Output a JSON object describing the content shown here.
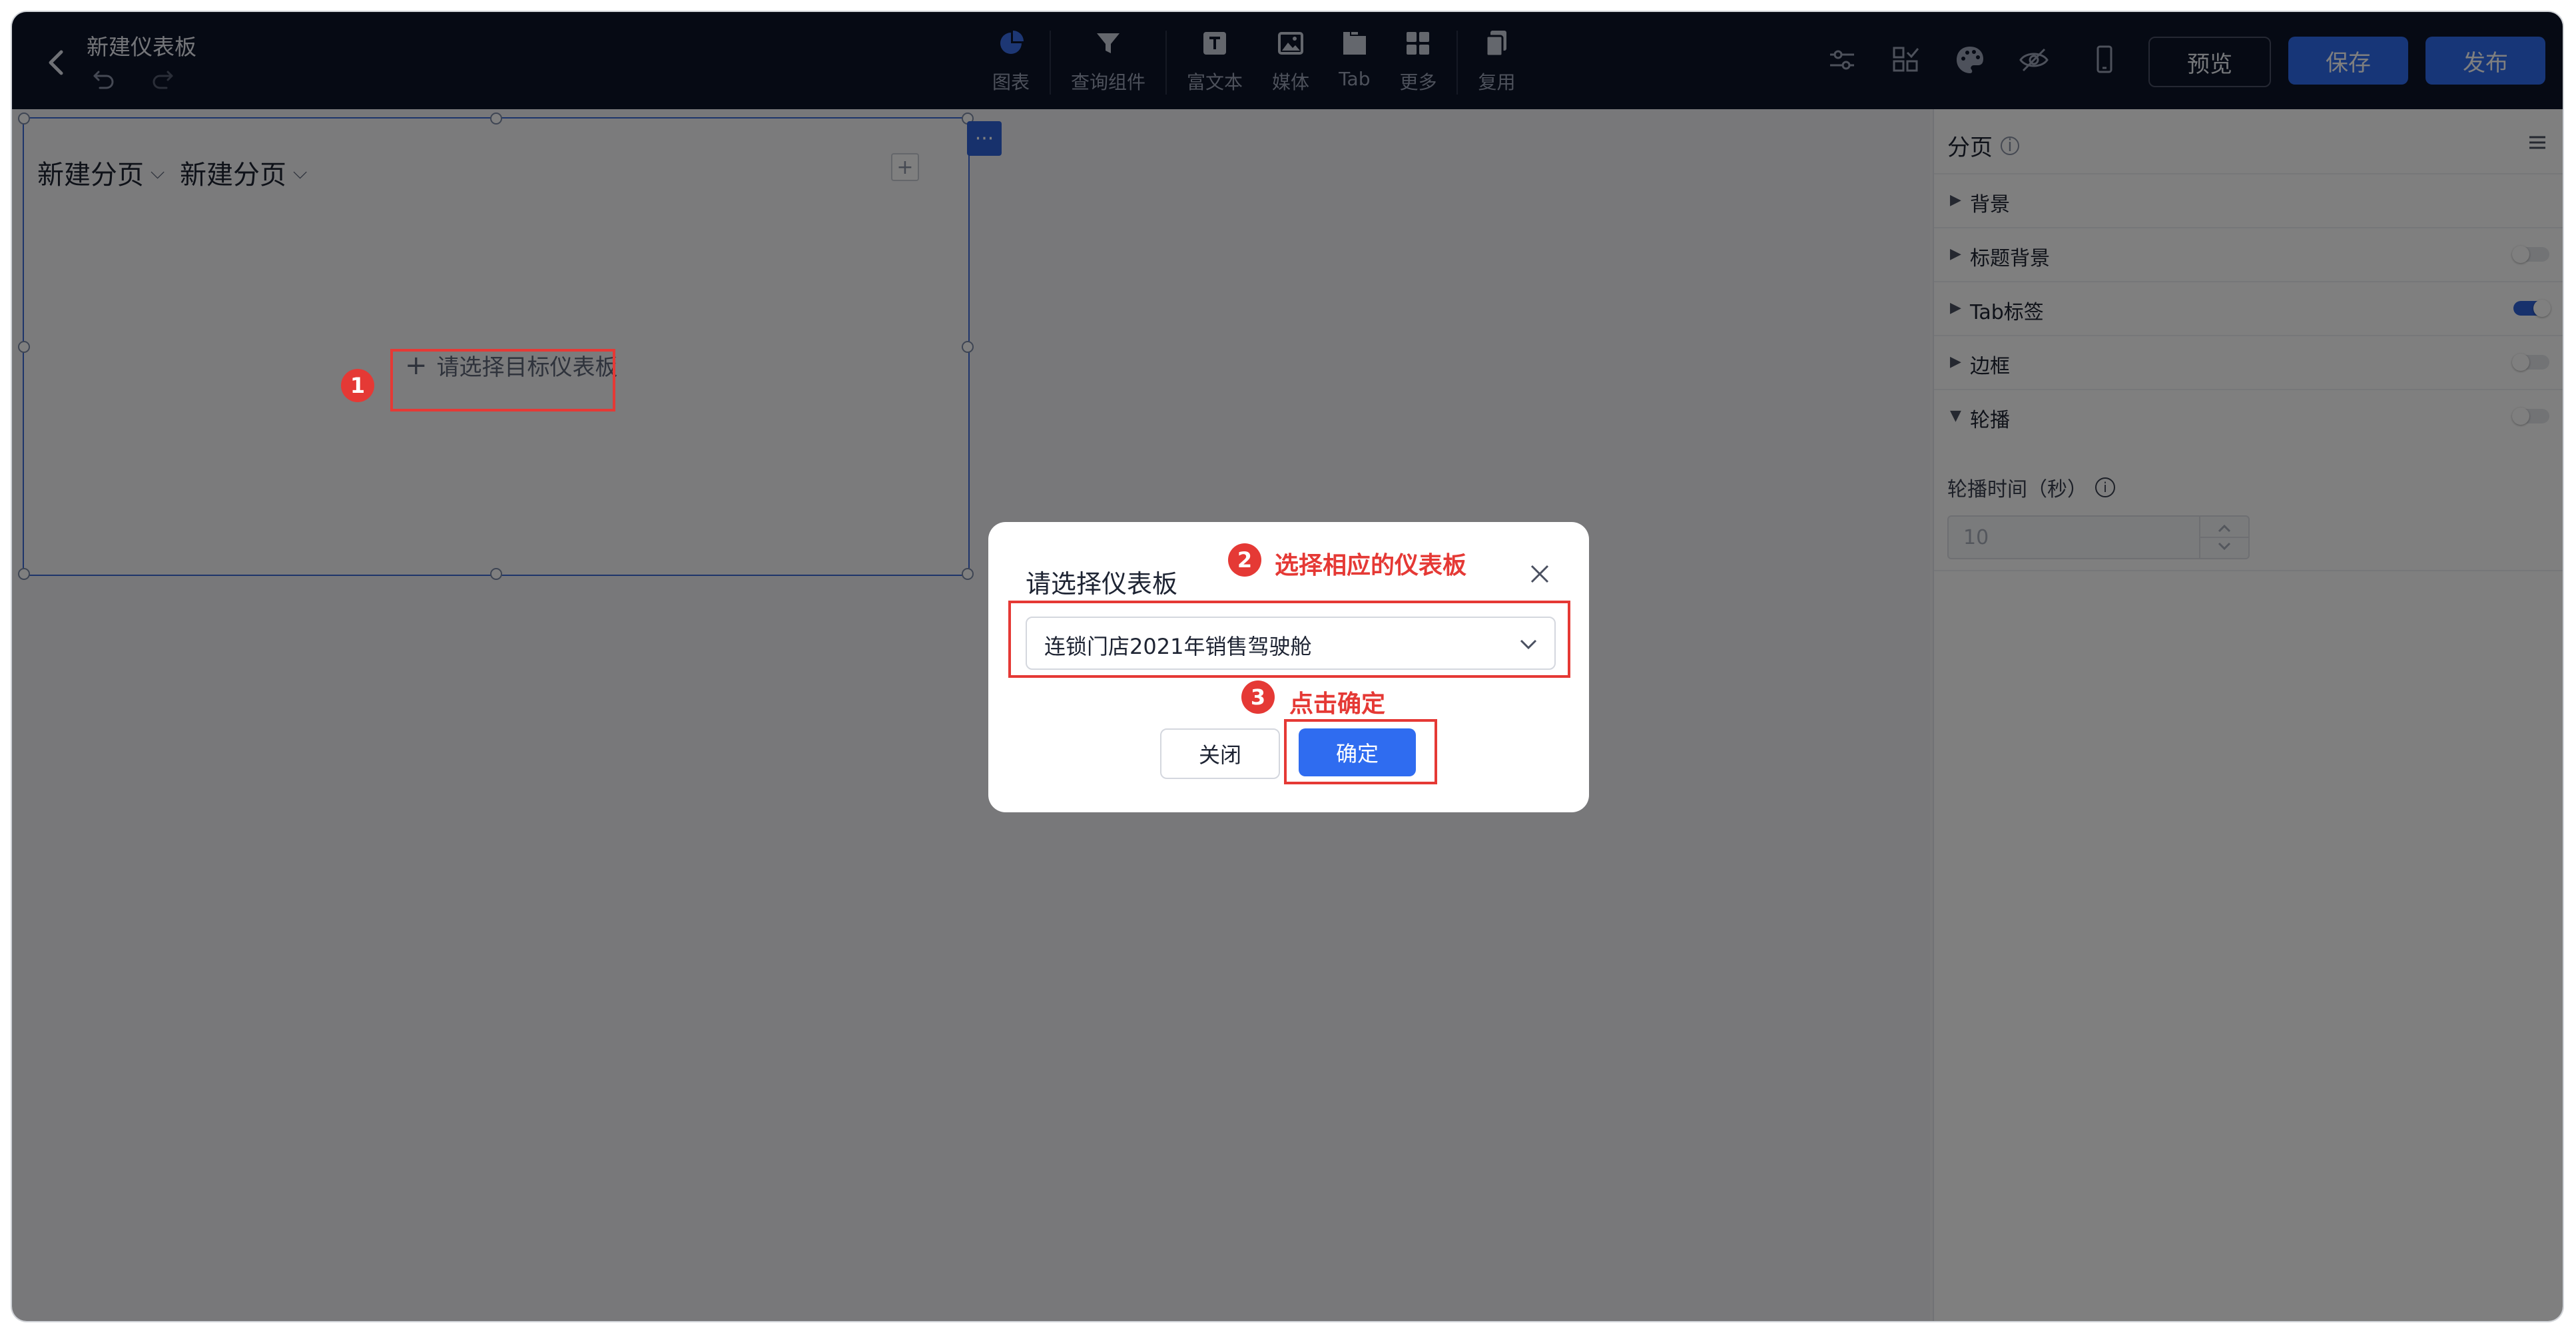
{
  "header": {
    "title": "新建仪表板",
    "tools": [
      {
        "label": "图表",
        "icon": "pie-chart-icon"
      },
      {
        "label": "查询组件",
        "icon": "filter-icon"
      },
      {
        "label": "富文本",
        "icon": "text-icon"
      },
      {
        "label": "媒体",
        "icon": "image-icon"
      },
      {
        "label": "Tab",
        "icon": "tab-icon"
      },
      {
        "label": "更多",
        "icon": "grid-icon"
      },
      {
        "label": "复用",
        "icon": "copy-icon"
      }
    ],
    "right_icons": [
      "settings-sliders-icon",
      "layout-check-icon",
      "palette-icon",
      "eye-off-icon",
      "mobile-icon"
    ],
    "preview_label": "预览",
    "save_label": "保存",
    "publish_label": "发布"
  },
  "canvas": {
    "tabs": [
      {
        "label": "新建分页"
      },
      {
        "label": "新建分页"
      }
    ],
    "add_tab_glyph": "+",
    "placeholder": "请选择目标仪表板",
    "more_glyph": "···"
  },
  "panel": {
    "title": "分页",
    "sections": [
      {
        "label": "背景",
        "expanded": false,
        "has_toggle": false,
        "on": false
      },
      {
        "label": "标题背景",
        "expanded": false,
        "has_toggle": true,
        "on": false
      },
      {
        "label": "Tab标签",
        "expanded": false,
        "has_toggle": true,
        "on": true
      },
      {
        "label": "边框",
        "expanded": false,
        "has_toggle": true,
        "on": false
      },
      {
        "label": "轮播",
        "expanded": true,
        "has_toggle": true,
        "on": false
      }
    ],
    "interval_label": "轮播时间（秒）",
    "interval_value": "10"
  },
  "modal": {
    "title": "请选择仪表板",
    "selected_dashboard": "连锁门店2021年销售驾驶舱",
    "close_label": "关闭",
    "ok_label": "确定"
  },
  "annotations": [
    {
      "number": "1",
      "text": ""
    },
    {
      "number": "2",
      "text": "选择相应的仪表板"
    },
    {
      "number": "3",
      "text": "点击确定"
    }
  ],
  "colors": {
    "topbar": "#0d1428",
    "accent": "#2f6cf0",
    "annotation": "#e53935"
  }
}
